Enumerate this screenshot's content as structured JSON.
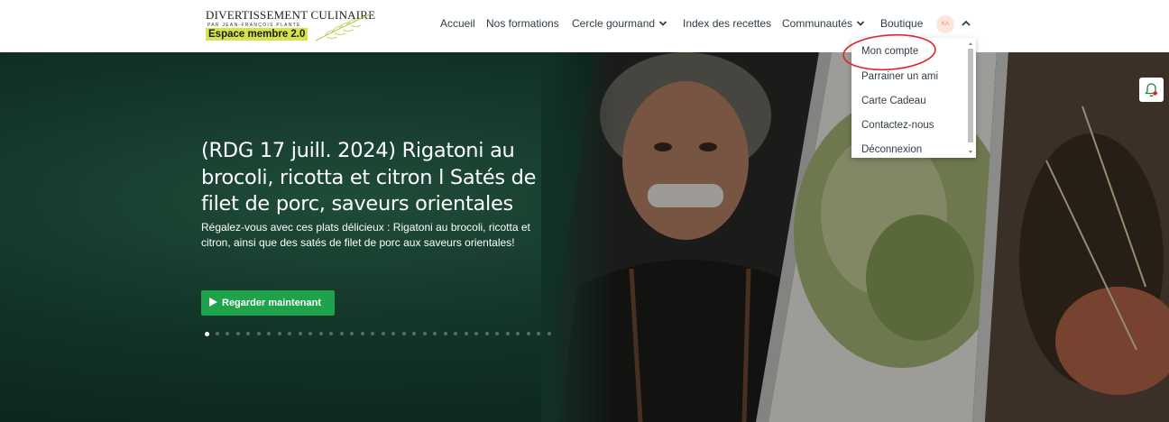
{
  "logo": {
    "title": "DIVERTISSEMENT CULINAIRE",
    "subtitle": "PAR JEAN-FRANÇOIS PLANTE",
    "badge": "Espace membre 2.0"
  },
  "nav": {
    "items": [
      {
        "label": "Accueil"
      },
      {
        "label": "Nos formations"
      },
      {
        "label": "Cercle gourmand"
      },
      {
        "label": "Index des recettes"
      },
      {
        "label": "Communautés"
      },
      {
        "label": "Boutique"
      }
    ],
    "avatar_initials": "KA"
  },
  "account_menu": {
    "items": [
      {
        "label": "Mon compte"
      },
      {
        "label": "Parrainer un ami"
      },
      {
        "label": "Carte Cadeau"
      },
      {
        "label": "Contactez-nous"
      },
      {
        "label": "Déconnexion"
      }
    ]
  },
  "hero": {
    "title": "(RDG 17 juill. 2024) Rigatoni au brocoli, ricotta et citron l Satés de filet de porc, saveurs orientales",
    "description": "Régalez-vous avec ces plats délicieux : Rigatoni au brocoli, ricotta et citron, ainsi que des satés de filet de porc aux saveurs orientales!",
    "cta_label": "Regarder maintenant",
    "slide_count": 34,
    "active_slide": 1
  },
  "colors": {
    "accent_green": "#1fa34a",
    "logo_badge": "#d7e34a",
    "annotation_red": "#e0262a",
    "hero_background": "#123227"
  },
  "icons": [
    "play-icon",
    "chevron-down-icon",
    "chevron-up-icon",
    "bell-icon",
    "leaf-icon"
  ]
}
